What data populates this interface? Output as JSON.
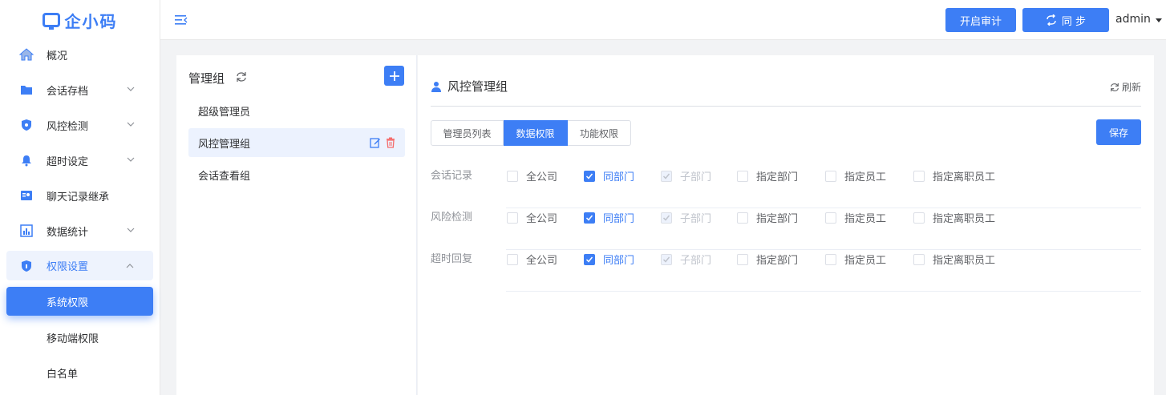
{
  "sidebar": {
    "logo_text": "企小码",
    "items": [
      {
        "label": "概况"
      },
      {
        "label": "会话存档"
      },
      {
        "label": "风控检测"
      },
      {
        "label": "超时设定"
      },
      {
        "label": "聊天记录继承"
      },
      {
        "label": "数据统计"
      },
      {
        "label": "权限设置"
      }
    ],
    "subitems": [
      {
        "label": "系统权限"
      },
      {
        "label": "移动端权限"
      },
      {
        "label": "白名单"
      }
    ]
  },
  "header": {
    "audit_button": "开启审计",
    "sync_button": "同 步",
    "user": "admin"
  },
  "groups": {
    "title": "管理组",
    "items": [
      {
        "label": "超级管理员"
      },
      {
        "label": "风控管理组"
      },
      {
        "label": "会话查看组"
      }
    ]
  },
  "detail": {
    "title": "风控管理组",
    "refresh": "刷新",
    "tabs": [
      {
        "label": "管理员列表"
      },
      {
        "label": "数据权限"
      },
      {
        "label": "功能权限"
      }
    ],
    "save": "保存",
    "options": [
      "全公司",
      "同部门",
      "子部门",
      "指定部门",
      "指定员工",
      "指定离职员工"
    ],
    "rows": [
      {
        "label": "会话记录",
        "checked": [
          false,
          true,
          true,
          false,
          false,
          false
        ]
      },
      {
        "label": "风险检测",
        "checked": [
          false,
          true,
          true,
          false,
          false,
          false
        ]
      },
      {
        "label": "超时回复",
        "checked": [
          false,
          true,
          true,
          false,
          false,
          false
        ]
      }
    ]
  },
  "colors": {
    "primary": "#3d7ef5",
    "danger": "#f56c6c"
  }
}
